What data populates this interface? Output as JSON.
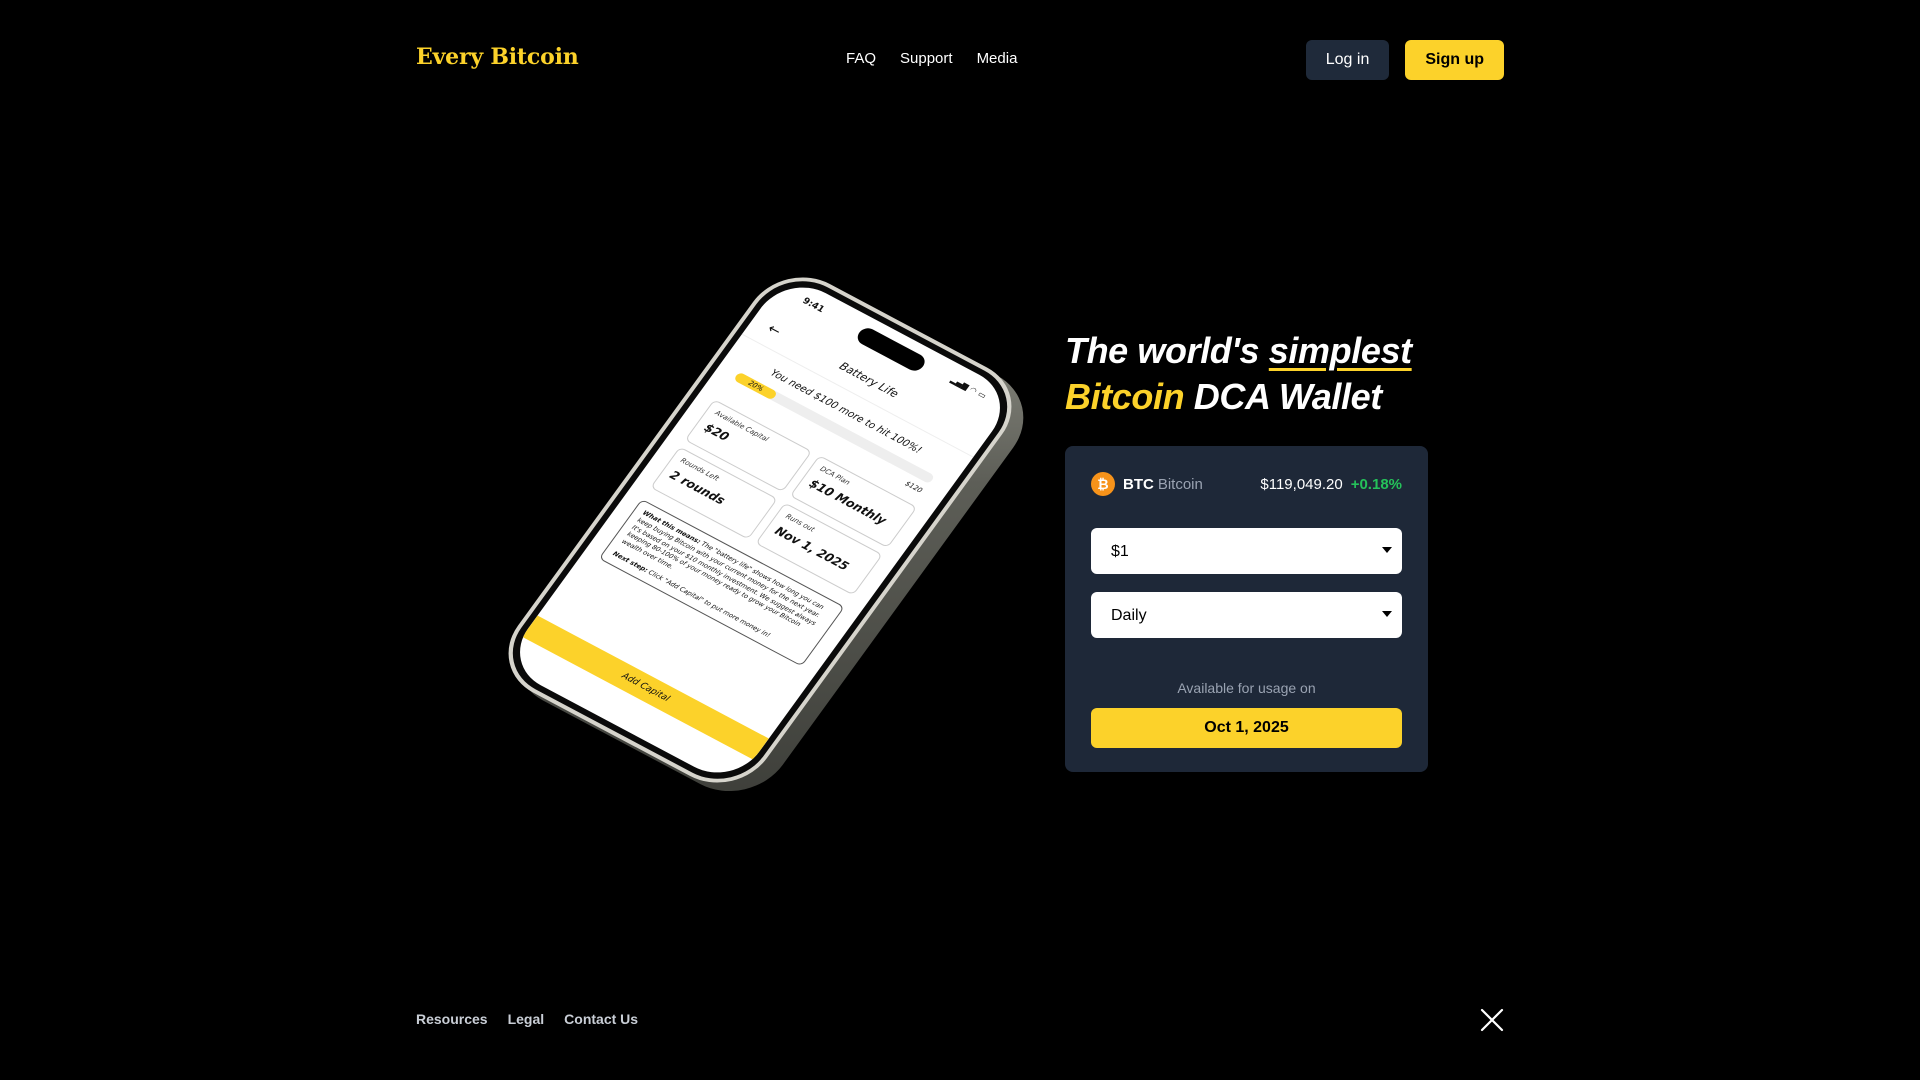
{
  "header": {
    "logo": "Every Bitcoin",
    "nav": [
      "FAQ",
      "Support",
      "Media"
    ],
    "login_label": "Log in",
    "signup_label": "Sign up"
  },
  "phone": {
    "time": "9:41",
    "title": "Battery Life",
    "need_text": "You need $100 more to hit 100%!",
    "progress_percent": 20,
    "progress_label": "20%",
    "progress_max": "$120",
    "stats": [
      {
        "label": "Available Capital",
        "value": "$20"
      },
      {
        "label": "DCA Plan",
        "value": "$10 Monthly"
      },
      {
        "label": "Rounds Left",
        "value": "2 rounds"
      },
      {
        "label": "Runs out",
        "value": "Nov 1, 2025"
      }
    ],
    "explain_bold": "What this means:",
    "explain_text": "The \"battery life\" shows how long you can keep buying Bitcoin with your current money for the next year. It's based on your $10 monthly investment. We suggest always keeping 80-100% of your money ready to grow your Bitcoin wealth over time.",
    "next_bold": "Next step:",
    "next_text": "Click \"Add Capital\" to put more money in!",
    "add_capital_label": "Add Capital"
  },
  "hero": {
    "line1_prefix": "The world's ",
    "line1_emph": "simplest",
    "line2_yellow": "Bitcoin",
    "line2_rest": " DCA Wallet"
  },
  "card": {
    "icon_symbol": "₿",
    "ticker": "BTC",
    "name": "Bitcoin",
    "price": "$119,049.20",
    "change": "+0.18%",
    "amount_value": "$1",
    "frequency_value": "Daily",
    "available_label": "Available for usage on",
    "date_label": "Oct 1, 2025"
  },
  "footer": {
    "links": [
      "Resources",
      "Legal",
      "Contact Us"
    ]
  },
  "colors": {
    "accent": "#fcd22a",
    "card_bg": "#1e2838",
    "positive": "#25c15a",
    "btc_orange": "#f7931a"
  }
}
